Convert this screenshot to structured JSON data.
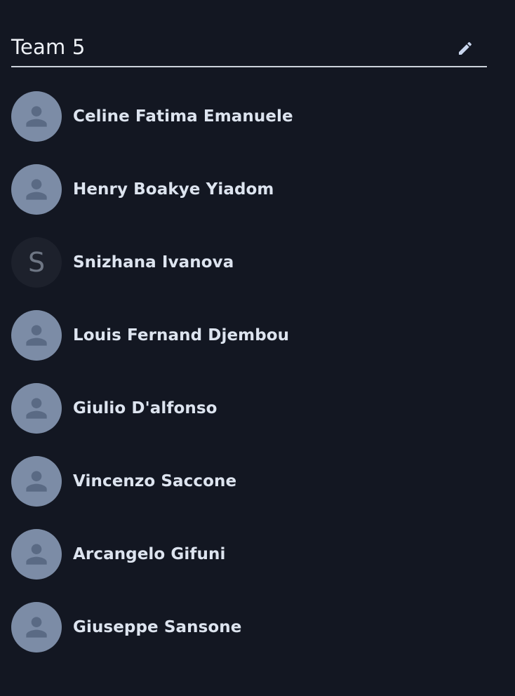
{
  "team": {
    "name": "Team 5",
    "edit_icon": "pencil-icon"
  },
  "members": [
    {
      "name": "Celine Fatima Emanuele",
      "avatar": "person-icon",
      "initial": ""
    },
    {
      "name": "Henry Boakye Yiadom",
      "avatar": "person-icon",
      "initial": ""
    },
    {
      "name": "Snizhana Ivanova",
      "avatar": "letter",
      "initial": "S"
    },
    {
      "name": "Louis Fernand Djembou",
      "avatar": "person-icon",
      "initial": ""
    },
    {
      "name": "Giulio D'alfonso",
      "avatar": "person-icon",
      "initial": ""
    },
    {
      "name": "Vincenzo Saccone",
      "avatar": "person-icon",
      "initial": ""
    },
    {
      "name": "Arcangelo Gifuni",
      "avatar": "person-icon",
      "initial": ""
    },
    {
      "name": "Giuseppe Sansone",
      "avatar": "person-icon",
      "initial": ""
    }
  ],
  "colors": {
    "background": "#131722",
    "avatar_bg": "#7c8ca6",
    "avatar_icon": "#5a6a84",
    "letter_avatar_bg": "#1d212c",
    "text": "#dde4ef"
  }
}
